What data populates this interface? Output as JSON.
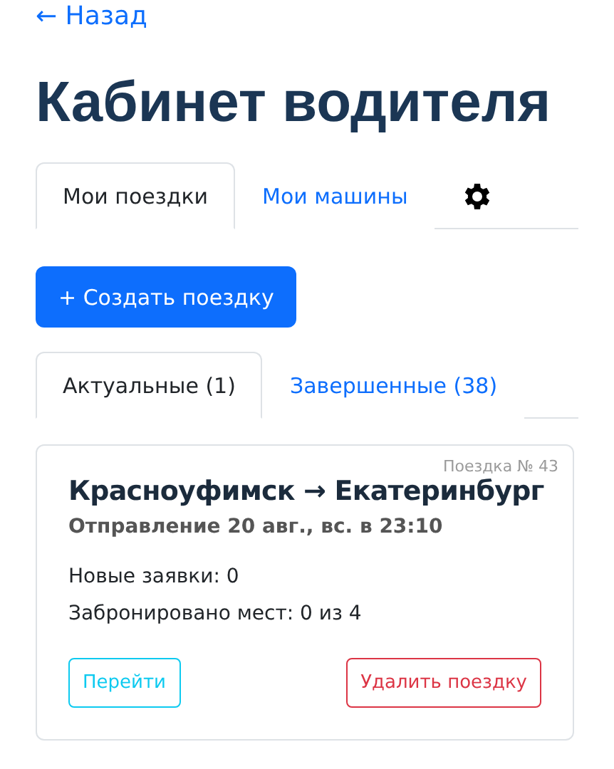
{
  "back_link": "← Назад",
  "title": "Кабинет водителя",
  "tabs": [
    {
      "label": "Мои поездки",
      "selected": true
    },
    {
      "label": "Мои машины",
      "selected": false
    }
  ],
  "create_button": "+ Создать поездку",
  "trip_tabs": [
    {
      "label": "Актуальные (1)",
      "selected": true
    },
    {
      "label": "Завершенные (38)",
      "selected": false
    }
  ],
  "trips": [
    {
      "number": "Поездка № 43",
      "route": "Красноуфимск → Екатеринбург",
      "departure": "Отправление 20 авг., вс. в 23:10",
      "details": [
        "Новые заявки: 0",
        "Забронировано мест: 0 из 4"
      ],
      "actions": [
        {
          "label": "Перейти",
          "kind": "info"
        },
        {
          "label": "Удалить поездку",
          "kind": "danger"
        }
      ]
    }
  ]
}
